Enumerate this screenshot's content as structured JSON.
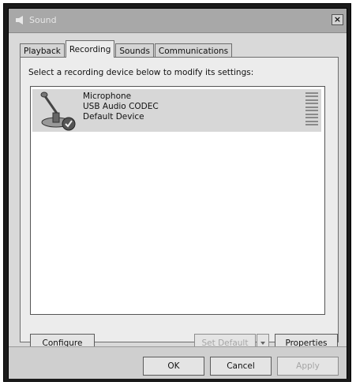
{
  "window": {
    "title": "Sound",
    "close_label": "×"
  },
  "tabs": [
    {
      "label": "Playback",
      "active": false
    },
    {
      "label": "Recording",
      "active": true
    },
    {
      "label": "Sounds",
      "active": false
    },
    {
      "label": "Communications",
      "active": false
    }
  ],
  "recording": {
    "instruction": "Select a recording device below to modify its settings:",
    "devices": [
      {
        "name": "Microphone",
        "driver": "USB Audio CODEC",
        "status": "Default Device",
        "icon": "microphone-icon"
      }
    ],
    "buttons": {
      "configure": "Configure",
      "set_default": "Set Default",
      "properties": "Properties"
    }
  },
  "footer": {
    "ok": "OK",
    "cancel": "Cancel",
    "apply": "Apply"
  },
  "colors": {
    "selection": "#d7d7d7",
    "disabled_text": "#a5a5a5"
  }
}
